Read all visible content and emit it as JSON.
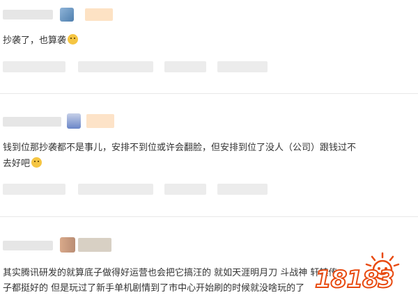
{
  "comments": [
    {
      "text": "抄袭了，也算袭",
      "emoji": "doge-emoji"
    },
    {
      "text_line1": "钱到位那抄袭都不是事儿，安排不到位或许会翻脸，但安排到位了没人（公司）跟钱过不",
      "text_line2": "去好吧",
      "emoji": "doge-emoji"
    },
    {
      "text_line1": "其实腾讯研发的就算底子做得好运营也会把它搞汪的    就如天涯明月刀  斗战神  轩辕传",
      "text_line2": "子都挺好的   但是玩过了新手单机剧情到了市中心开始刷的时候就没啥玩的了"
    }
  ],
  "watermark": {
    "text": "18183",
    "icon": "sun-mascot-icon"
  },
  "colors": {
    "divider": "#e8e8e8",
    "blur_gray": "#e4e4e4",
    "watermark_orange": "#e84a10"
  }
}
